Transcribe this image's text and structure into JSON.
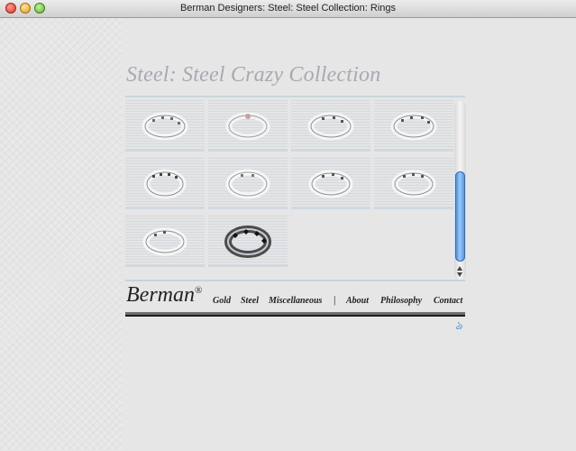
{
  "window": {
    "title": "Berman Designers: Steel: Steel  Collection: Rings"
  },
  "page": {
    "heading": "Steel: Steel Crazy Collection"
  },
  "gallery": {
    "thumbnails": [
      {
        "name": "ring-1"
      },
      {
        "name": "ring-2"
      },
      {
        "name": "ring-3"
      },
      {
        "name": "ring-4"
      },
      {
        "name": "ring-5"
      },
      {
        "name": "ring-6"
      },
      {
        "name": "ring-7"
      },
      {
        "name": "ring-8"
      },
      {
        "name": "ring-9"
      },
      {
        "name": "ring-10-selected"
      }
    ],
    "icons": {
      "scroll_up": "arrow-up-icon",
      "scroll_down": "arrow-down-icon"
    }
  },
  "brand": {
    "name": "Berman",
    "mark": "®"
  },
  "nav": {
    "items": [
      "Gold",
      "Steel",
      "Miscellaneous",
      "About",
      "Philosophy",
      "Contact"
    ],
    "separator": "|"
  },
  "footer": {
    "corner_glyph": "ঌ"
  },
  "colors": {
    "heading": "#a6aab0",
    "scroll_thumb": "#3d7fd6",
    "accent": "#4f8fd8"
  }
}
